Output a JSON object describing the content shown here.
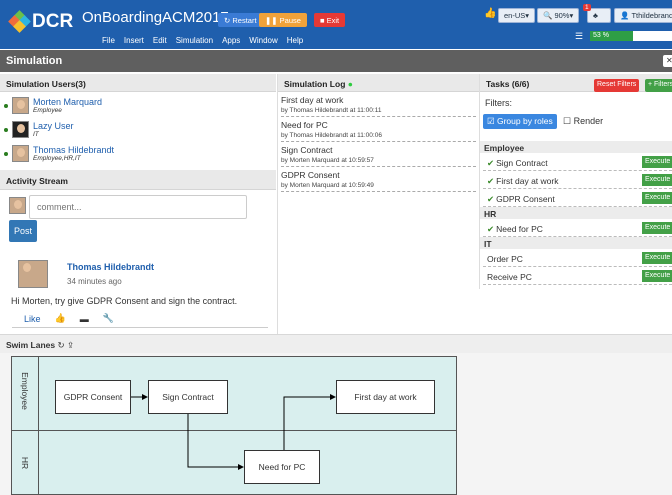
{
  "header": {
    "title": "OnBoardingACM2017",
    "restart": "Restart",
    "pause": "Pause",
    "exit": "Exit",
    "menu": [
      "File",
      "Insert",
      "Edit",
      "Simulation",
      "Apps",
      "Window",
      "Help"
    ],
    "lang": "en-US▾",
    "zoom": "90%▾",
    "notif": "1",
    "username": "Tthildebrandt",
    "progress": "53 %",
    "progress_value": 0.53
  },
  "simulation_title": "Simulation",
  "users_panel": {
    "title": "Simulation Users(3)",
    "users": [
      {
        "name": "Morten Marquard",
        "role": "Employee"
      },
      {
        "name": "Lazy User",
        "role": "IT"
      },
      {
        "name": "Thomas Hildebrandt",
        "role": "Employee,HR,IT"
      }
    ]
  },
  "activity": {
    "title": "Activity Stream",
    "comment_placeholder": "comment...",
    "post": "Post",
    "author": "Thomas Hildebrandt",
    "time": "34 minutes ago",
    "text": "Hi Morten, try give GDPR Consent and sign the contract.",
    "like": "Like"
  },
  "log": {
    "title": "Simulation Log",
    "entries": [
      {
        "title": "First day at work",
        "by": "by Thomas Hildebrandt at 11:00:11"
      },
      {
        "title": "Need for PC",
        "by": "by Thomas Hildebrandt at 11:00:06"
      },
      {
        "title": "Sign Contract",
        "by": "by Morten Marquard at 10:59:57"
      },
      {
        "title": "GDPR Consent",
        "by": "by Morten Marquard at 10:59:49"
      }
    ]
  },
  "tasks": {
    "title": "Tasks (6/6)",
    "reset": "Reset Filters",
    "add_filters": "+ Filters",
    "filters_label": "Filters:",
    "group_by_roles": "Group by roles",
    "render": "Render",
    "execute": "Execute",
    "groups": [
      {
        "name": "Employee",
        "items": [
          "Sign Contract",
          "First day at work",
          "GDPR Consent"
        ],
        "done": [
          true,
          true,
          true
        ]
      },
      {
        "name": "HR",
        "items": [
          "Need for PC"
        ],
        "done": [
          true
        ]
      },
      {
        "name": "IT",
        "items": [
          "Order PC",
          "Receive PC"
        ],
        "done": [
          false,
          false
        ]
      }
    ]
  },
  "swimlanes": {
    "title": "Swim Lanes",
    "lanes": [
      "Employee",
      "HR"
    ],
    "boxes": [
      "GDPR Consent",
      "Sign Contract",
      "First day at work",
      "Need for PC"
    ]
  }
}
